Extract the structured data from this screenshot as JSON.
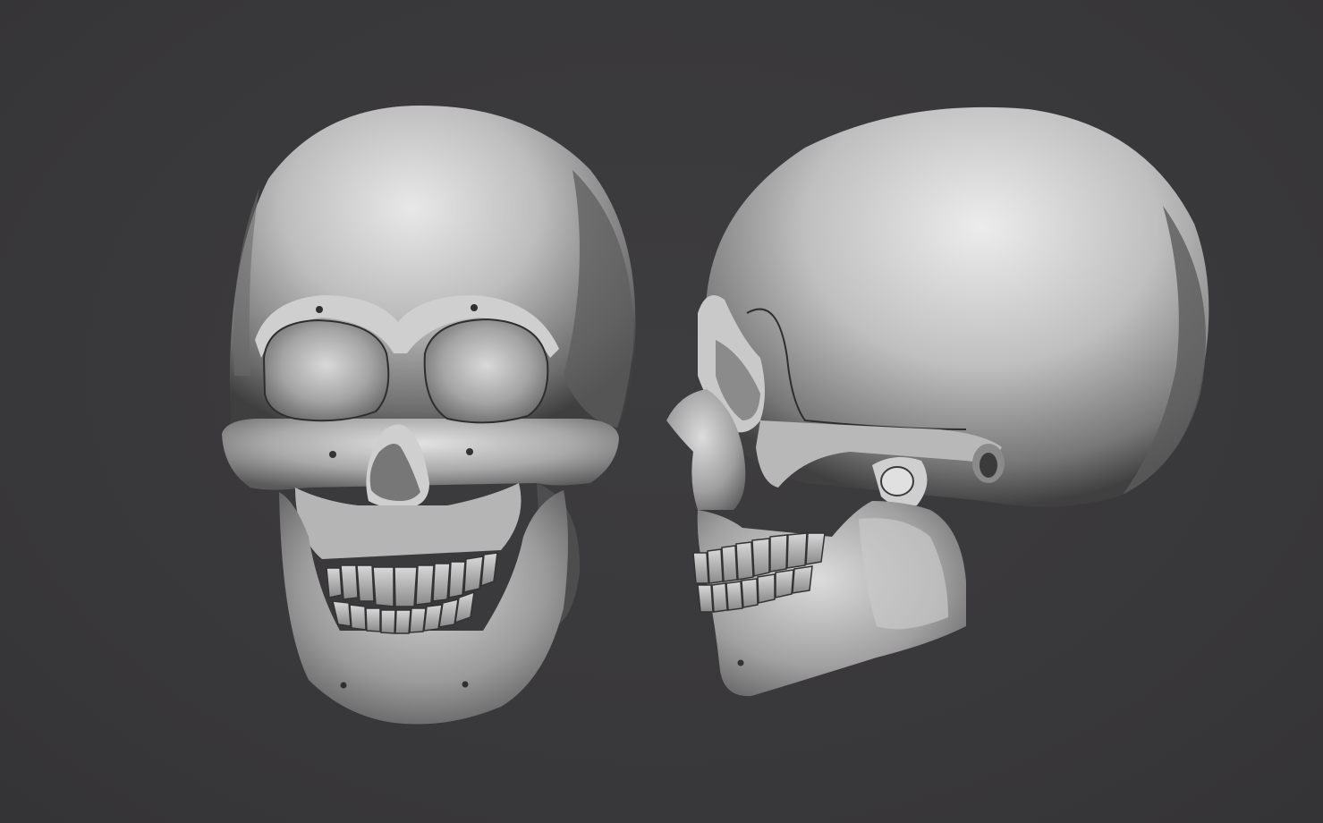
{
  "scene": {
    "background_color": "#3a393b",
    "material_color": "#bcbcbc",
    "objects": [
      {
        "name": "skull-front-view",
        "view": "front"
      },
      {
        "name": "skull-side-view",
        "view": "side"
      }
    ]
  }
}
